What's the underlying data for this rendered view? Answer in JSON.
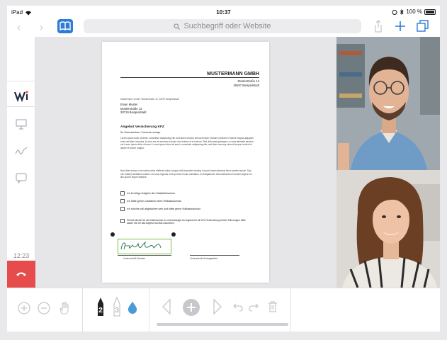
{
  "status_bar": {
    "device": "iPad",
    "time": "10:37",
    "battery": "100 %"
  },
  "toolbar": {
    "search_placeholder": "Suchbegriff oder Website"
  },
  "sidebar": {
    "clock": "12:23"
  },
  "document": {
    "company": "MUSTERMANN GMBH",
    "company_address": [
      "Musterstraße 12",
      "28197 Beispielstadt"
    ],
    "sender_line": "Mustermann GmbH, Musterstraße 12, 28197 Beispielstadt",
    "recipient": [
      "Erwin Muster",
      "Musterstraße 12",
      "28719 Beispielstadt"
    ],
    "subject": "Angebot Versicherung KFZ",
    "greeting": "Ihr Kennzeichen: Formula numqu.",
    "paragraph1": "Lorem ipsum dolor sit amet, consetetur sadipscing elitr, sed diam nonumy eirmod tempor invidunt ut labore et dolore magna aliquyam erat, sed diam voluptua. At vero eos et accusam et justo duo dolores et ea rebum. Stet clita kasd gubergren, no sea takimata sanctus est Lorem ipsum dolor sit amet. Lorem ipsum dolor sit amet, consetetur sadipscing elitr, sed diam nonumy eirmod tempor invidunt ut labore et dolore magna.",
    "paragraph2": "Nam liber tempor cum soluta nobis eleifend option congue nihil imperdiet doming id quod mazim placerat facer possim assum. Typi non habent claritatem insitam; est usus legentis in iis qui facit eorum claritatem. Investigationes demonstraverunt lectores legere me lius quod ii legunt saepius.",
    "checkboxes": [
      "Ich benötige lediglich den Haftpflichtschutz.",
      "Ich hätte gerne zusätzlich einen Teilkaskoschutz.",
      "Ich möchte voll abgesichert sein und hätte gerne Vollkaskoschutz."
    ],
    "consent": "Hiermit stimme ich den Datenschutz zu und beantrage ein Angebot für die KFZ-Versicherung meines Fahrzeuges. Bitte lassen Sie mir das Angebot via Mail zukommen.",
    "sig_label_left": "Unterschrift Berater",
    "sig_label_right": "Unterschrift Antragsteller"
  },
  "bottom_bar": {
    "pen_1": "2",
    "pen_2": "3"
  },
  "colors": {
    "accent": "#2e7cd6",
    "hangup": "#e74c4c",
    "signature_frame": "#7dbd4b",
    "signature_ink": "#2a7f4a"
  }
}
